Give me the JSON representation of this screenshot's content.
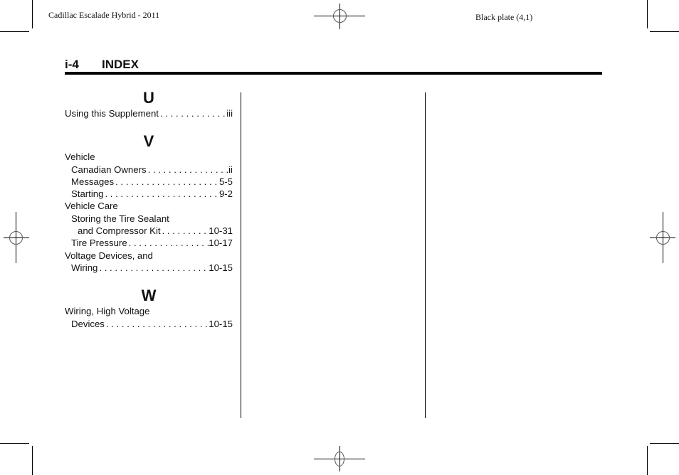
{
  "slug": {
    "left": "Cadillac Escalade Hybrid - 2011",
    "right": "Black plate (4,1)"
  },
  "header": {
    "page_number": "i-4",
    "title": "INDEX"
  },
  "sections": [
    {
      "letter": "U",
      "entries": [
        {
          "text": "Using this Supplement",
          "page": "iii",
          "level": 0
        }
      ]
    },
    {
      "letter": "V",
      "entries": [
        {
          "text": "Vehicle",
          "page": "",
          "level": 0
        },
        {
          "text": "Canadian Owners",
          "page": "ii",
          "level": 1
        },
        {
          "text": "Messages",
          "page": "5-5",
          "level": 1
        },
        {
          "text": "Starting",
          "page": "9-2",
          "level": 1
        },
        {
          "text": "Vehicle Care",
          "page": "",
          "level": 0
        },
        {
          "text": "Storing the Tire Sealant",
          "page": "",
          "level": 1
        },
        {
          "text": "and Compressor Kit",
          "page": "10-31",
          "level": 2
        },
        {
          "text": "Tire Pressure",
          "page": "10-17",
          "level": 1
        },
        {
          "text": "Voltage Devices, and",
          "page": "",
          "level": 0
        },
        {
          "text": "Wiring",
          "page": "10-15",
          "level": 1
        }
      ]
    },
    {
      "letter": "W",
      "entries": [
        {
          "text": "Wiring, High Voltage",
          "page": "",
          "level": 0
        },
        {
          "text": "Devices",
          "page": "10-15",
          "level": 1
        }
      ]
    }
  ]
}
